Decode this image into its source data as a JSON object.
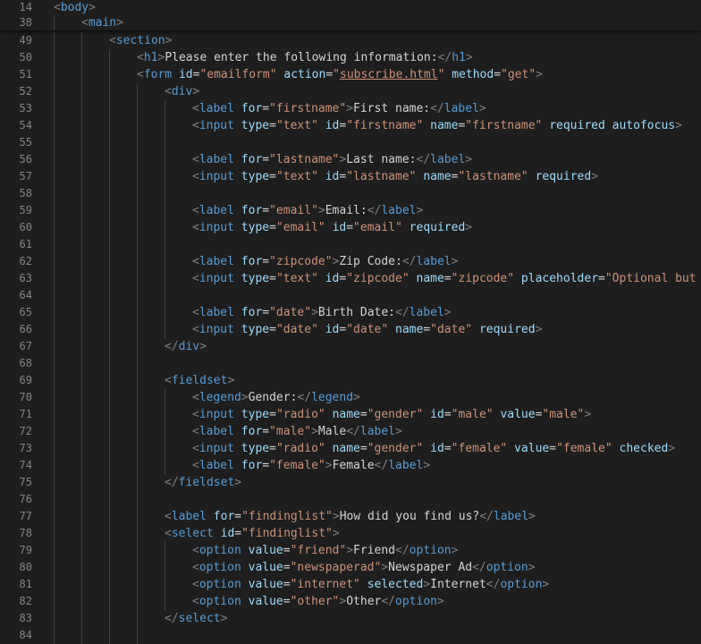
{
  "sticky": [
    {
      "n": "14",
      "indent": 0,
      "segs": [
        [
          "p",
          "<"
        ],
        [
          "t",
          "body"
        ],
        [
          "p",
          ">"
        ]
      ]
    },
    {
      "n": "38",
      "indent": 1,
      "segs": [
        [
          "p",
          "<"
        ],
        [
          "t",
          "main"
        ],
        [
          "p",
          ">"
        ]
      ]
    }
  ],
  "lines": [
    {
      "n": "49",
      "indent": 2,
      "segs": [
        [
          "p",
          "<"
        ],
        [
          "t",
          "section"
        ],
        [
          "p",
          ">"
        ]
      ]
    },
    {
      "n": "50",
      "indent": 3,
      "segs": [
        [
          "p",
          "<"
        ],
        [
          "t",
          "h1"
        ],
        [
          "p",
          ">"
        ],
        [
          "tx",
          "Please enter the following information:"
        ],
        [
          "p",
          "</"
        ],
        [
          "t",
          "h1"
        ],
        [
          "p",
          ">"
        ]
      ]
    },
    {
      "n": "51",
      "indent": 3,
      "segs": [
        [
          "p",
          "<"
        ],
        [
          "t",
          "form"
        ],
        [
          "tx",
          " "
        ],
        [
          "a",
          "id"
        ],
        [
          "tx",
          "="
        ],
        [
          "v",
          "\"emailform\""
        ],
        [
          "tx",
          " "
        ],
        [
          "a",
          "action"
        ],
        [
          "tx",
          "="
        ],
        [
          "v",
          "\""
        ],
        [
          "vu",
          "subscribe.html"
        ],
        [
          "v",
          "\""
        ],
        [
          "tx",
          " "
        ],
        [
          "a",
          "method"
        ],
        [
          "tx",
          "="
        ],
        [
          "v",
          "\"get\""
        ],
        [
          "p",
          ">"
        ]
      ]
    },
    {
      "n": "52",
      "indent": 4,
      "segs": [
        [
          "p",
          "<"
        ],
        [
          "t",
          "div"
        ],
        [
          "p",
          ">"
        ]
      ]
    },
    {
      "n": "53",
      "indent": 5,
      "segs": [
        [
          "p",
          "<"
        ],
        [
          "t",
          "label"
        ],
        [
          "tx",
          " "
        ],
        [
          "a",
          "for"
        ],
        [
          "tx",
          "="
        ],
        [
          "v",
          "\"firstname\""
        ],
        [
          "p",
          ">"
        ],
        [
          "tx",
          "First name:"
        ],
        [
          "p",
          "</"
        ],
        [
          "t",
          "label"
        ],
        [
          "p",
          ">"
        ]
      ]
    },
    {
      "n": "54",
      "indent": 5,
      "segs": [
        [
          "p",
          "<"
        ],
        [
          "t",
          "input"
        ],
        [
          "tx",
          " "
        ],
        [
          "a",
          "type"
        ],
        [
          "tx",
          "="
        ],
        [
          "v",
          "\"text\""
        ],
        [
          "tx",
          " "
        ],
        [
          "a",
          "id"
        ],
        [
          "tx",
          "="
        ],
        [
          "v",
          "\"firstname\""
        ],
        [
          "tx",
          " "
        ],
        [
          "a",
          "name"
        ],
        [
          "tx",
          "="
        ],
        [
          "v",
          "\"firstname\""
        ],
        [
          "tx",
          " "
        ],
        [
          "a",
          "required"
        ],
        [
          "tx",
          " "
        ],
        [
          "a",
          "autofocus"
        ],
        [
          "p",
          ">"
        ]
      ]
    },
    {
      "n": "55",
      "indent": 5,
      "segs": []
    },
    {
      "n": "56",
      "indent": 5,
      "segs": [
        [
          "p",
          "<"
        ],
        [
          "t",
          "label"
        ],
        [
          "tx",
          " "
        ],
        [
          "a",
          "for"
        ],
        [
          "tx",
          "="
        ],
        [
          "v",
          "\"lastname\""
        ],
        [
          "p",
          ">"
        ],
        [
          "tx",
          "Last name:"
        ],
        [
          "p",
          "</"
        ],
        [
          "t",
          "label"
        ],
        [
          "p",
          ">"
        ]
      ]
    },
    {
      "n": "57",
      "indent": 5,
      "segs": [
        [
          "p",
          "<"
        ],
        [
          "t",
          "input"
        ],
        [
          "tx",
          " "
        ],
        [
          "a",
          "type"
        ],
        [
          "tx",
          "="
        ],
        [
          "v",
          "\"text\""
        ],
        [
          "tx",
          " "
        ],
        [
          "a",
          "id"
        ],
        [
          "tx",
          "="
        ],
        [
          "v",
          "\"lastname\""
        ],
        [
          "tx",
          " "
        ],
        [
          "a",
          "name"
        ],
        [
          "tx",
          "="
        ],
        [
          "v",
          "\"lastname\""
        ],
        [
          "tx",
          " "
        ],
        [
          "a",
          "required"
        ],
        [
          "p",
          ">"
        ]
      ]
    },
    {
      "n": "58",
      "indent": 5,
      "segs": []
    },
    {
      "n": "59",
      "indent": 5,
      "segs": [
        [
          "p",
          "<"
        ],
        [
          "t",
          "label"
        ],
        [
          "tx",
          " "
        ],
        [
          "a",
          "for"
        ],
        [
          "tx",
          "="
        ],
        [
          "v",
          "\"email\""
        ],
        [
          "p",
          ">"
        ],
        [
          "tx",
          "Email:"
        ],
        [
          "p",
          "</"
        ],
        [
          "t",
          "label"
        ],
        [
          "p",
          ">"
        ]
      ]
    },
    {
      "n": "60",
      "indent": 5,
      "segs": [
        [
          "p",
          "<"
        ],
        [
          "t",
          "input"
        ],
        [
          "tx",
          " "
        ],
        [
          "a",
          "type"
        ],
        [
          "tx",
          "="
        ],
        [
          "v",
          "\"email\""
        ],
        [
          "tx",
          " "
        ],
        [
          "a",
          "id"
        ],
        [
          "tx",
          "="
        ],
        [
          "v",
          "\"email\""
        ],
        [
          "tx",
          " "
        ],
        [
          "a",
          "required"
        ],
        [
          "p",
          ">"
        ]
      ]
    },
    {
      "n": "61",
      "indent": 5,
      "segs": []
    },
    {
      "n": "62",
      "indent": 5,
      "segs": [
        [
          "p",
          "<"
        ],
        [
          "t",
          "label"
        ],
        [
          "tx",
          " "
        ],
        [
          "a",
          "for"
        ],
        [
          "tx",
          "="
        ],
        [
          "v",
          "\"zipcode\""
        ],
        [
          "p",
          ">"
        ],
        [
          "tx",
          "Zip Code:"
        ],
        [
          "p",
          "</"
        ],
        [
          "t",
          "label"
        ],
        [
          "p",
          ">"
        ]
      ]
    },
    {
      "n": "63",
      "indent": 5,
      "segs": [
        [
          "p",
          "<"
        ],
        [
          "t",
          "input"
        ],
        [
          "tx",
          " "
        ],
        [
          "a",
          "type"
        ],
        [
          "tx",
          "="
        ],
        [
          "v",
          "\"text\""
        ],
        [
          "tx",
          " "
        ],
        [
          "a",
          "id"
        ],
        [
          "tx",
          "="
        ],
        [
          "v",
          "\"zipcode\""
        ],
        [
          "tx",
          " "
        ],
        [
          "a",
          "name"
        ],
        [
          "tx",
          "="
        ],
        [
          "v",
          "\"zipcode\""
        ],
        [
          "tx",
          " "
        ],
        [
          "a",
          "placeholder"
        ],
        [
          "tx",
          "="
        ],
        [
          "v",
          "\"Optional but a"
        ]
      ]
    },
    {
      "n": "64",
      "indent": 5,
      "segs": []
    },
    {
      "n": "65",
      "indent": 5,
      "segs": [
        [
          "p",
          "<"
        ],
        [
          "t",
          "label"
        ],
        [
          "tx",
          " "
        ],
        [
          "a",
          "for"
        ],
        [
          "tx",
          "="
        ],
        [
          "v",
          "\"date\""
        ],
        [
          "p",
          ">"
        ],
        [
          "tx",
          "Birth Date:"
        ],
        [
          "p",
          "</"
        ],
        [
          "t",
          "label"
        ],
        [
          "p",
          ">"
        ]
      ]
    },
    {
      "n": "66",
      "indent": 5,
      "segs": [
        [
          "p",
          "<"
        ],
        [
          "t",
          "input"
        ],
        [
          "tx",
          " "
        ],
        [
          "a",
          "type"
        ],
        [
          "tx",
          "="
        ],
        [
          "v",
          "\"date\""
        ],
        [
          "tx",
          " "
        ],
        [
          "a",
          "id"
        ],
        [
          "tx",
          "="
        ],
        [
          "v",
          "\"date\""
        ],
        [
          "tx",
          " "
        ],
        [
          "a",
          "name"
        ],
        [
          "tx",
          "="
        ],
        [
          "v",
          "\"date\""
        ],
        [
          "tx",
          " "
        ],
        [
          "a",
          "required"
        ],
        [
          "p",
          ">"
        ]
      ]
    },
    {
      "n": "67",
      "indent": 4,
      "segs": [
        [
          "p",
          "</"
        ],
        [
          "t",
          "div"
        ],
        [
          "p",
          ">"
        ]
      ]
    },
    {
      "n": "68",
      "indent": 4,
      "segs": []
    },
    {
      "n": "69",
      "indent": 4,
      "segs": [
        [
          "p",
          "<"
        ],
        [
          "t",
          "fieldset"
        ],
        [
          "p",
          ">"
        ]
      ]
    },
    {
      "n": "70",
      "indent": 5,
      "segs": [
        [
          "p",
          "<"
        ],
        [
          "t",
          "legend"
        ],
        [
          "p",
          ">"
        ],
        [
          "tx",
          "Gender:"
        ],
        [
          "p",
          "</"
        ],
        [
          "t",
          "legend"
        ],
        [
          "p",
          ">"
        ]
      ]
    },
    {
      "n": "71",
      "indent": 5,
      "segs": [
        [
          "p",
          "<"
        ],
        [
          "t",
          "input"
        ],
        [
          "tx",
          " "
        ],
        [
          "a",
          "type"
        ],
        [
          "tx",
          "="
        ],
        [
          "v",
          "\"radio\""
        ],
        [
          "tx",
          " "
        ],
        [
          "a",
          "name"
        ],
        [
          "tx",
          "="
        ],
        [
          "v",
          "\"gender\""
        ],
        [
          "tx",
          " "
        ],
        [
          "a",
          "id"
        ],
        [
          "tx",
          "="
        ],
        [
          "v",
          "\"male\""
        ],
        [
          "tx",
          " "
        ],
        [
          "a",
          "value"
        ],
        [
          "tx",
          "="
        ],
        [
          "v",
          "\"male\""
        ],
        [
          "p",
          ">"
        ]
      ]
    },
    {
      "n": "72",
      "indent": 5,
      "segs": [
        [
          "p",
          "<"
        ],
        [
          "t",
          "label"
        ],
        [
          "tx",
          " "
        ],
        [
          "a",
          "for"
        ],
        [
          "tx",
          "="
        ],
        [
          "v",
          "\"male\""
        ],
        [
          "p",
          ">"
        ],
        [
          "tx",
          "Male"
        ],
        [
          "p",
          "</"
        ],
        [
          "t",
          "label"
        ],
        [
          "p",
          ">"
        ]
      ]
    },
    {
      "n": "73",
      "indent": 5,
      "segs": [
        [
          "p",
          "<"
        ],
        [
          "t",
          "input"
        ],
        [
          "tx",
          " "
        ],
        [
          "a",
          "type"
        ],
        [
          "tx",
          "="
        ],
        [
          "v",
          "\"radio\""
        ],
        [
          "tx",
          " "
        ],
        [
          "a",
          "name"
        ],
        [
          "tx",
          "="
        ],
        [
          "v",
          "\"gender\""
        ],
        [
          "tx",
          " "
        ],
        [
          "a",
          "id"
        ],
        [
          "tx",
          "="
        ],
        [
          "v",
          "\"female\""
        ],
        [
          "tx",
          " "
        ],
        [
          "a",
          "value"
        ],
        [
          "tx",
          "="
        ],
        [
          "v",
          "\"female\""
        ],
        [
          "tx",
          " "
        ],
        [
          "a",
          "checked"
        ],
        [
          "p",
          ">"
        ]
      ]
    },
    {
      "n": "74",
      "indent": 5,
      "segs": [
        [
          "p",
          "<"
        ],
        [
          "t",
          "label"
        ],
        [
          "tx",
          " "
        ],
        [
          "a",
          "for"
        ],
        [
          "tx",
          "="
        ],
        [
          "v",
          "\"female\""
        ],
        [
          "p",
          ">"
        ],
        [
          "tx",
          "Female"
        ],
        [
          "p",
          "</"
        ],
        [
          "t",
          "label"
        ],
        [
          "p",
          ">"
        ]
      ]
    },
    {
      "n": "75",
      "indent": 4,
      "segs": [
        [
          "p",
          "</"
        ],
        [
          "t",
          "fieldset"
        ],
        [
          "p",
          ">"
        ]
      ]
    },
    {
      "n": "76",
      "indent": 4,
      "segs": []
    },
    {
      "n": "77",
      "indent": 4,
      "segs": [
        [
          "p",
          "<"
        ],
        [
          "t",
          "label"
        ],
        [
          "tx",
          " "
        ],
        [
          "a",
          "for"
        ],
        [
          "tx",
          "="
        ],
        [
          "v",
          "\"findinglist\""
        ],
        [
          "p",
          ">"
        ],
        [
          "tx",
          "How did you find us?"
        ],
        [
          "p",
          "</"
        ],
        [
          "t",
          "label"
        ],
        [
          "p",
          ">"
        ]
      ]
    },
    {
      "n": "78",
      "indent": 4,
      "segs": [
        [
          "p",
          "<"
        ],
        [
          "t",
          "select"
        ],
        [
          "tx",
          " "
        ],
        [
          "a",
          "id"
        ],
        [
          "tx",
          "="
        ],
        [
          "v",
          "\"findinglist\""
        ],
        [
          "p",
          ">"
        ]
      ]
    },
    {
      "n": "79",
      "indent": 5,
      "segs": [
        [
          "p",
          "<"
        ],
        [
          "t",
          "option"
        ],
        [
          "tx",
          " "
        ],
        [
          "a",
          "value"
        ],
        [
          "tx",
          "="
        ],
        [
          "v",
          "\"friend\""
        ],
        [
          "p",
          ">"
        ],
        [
          "tx",
          "Friend"
        ],
        [
          "p",
          "</"
        ],
        [
          "t",
          "option"
        ],
        [
          "p",
          ">"
        ]
      ]
    },
    {
      "n": "80",
      "indent": 5,
      "segs": [
        [
          "p",
          "<"
        ],
        [
          "t",
          "option"
        ],
        [
          "tx",
          " "
        ],
        [
          "a",
          "value"
        ],
        [
          "tx",
          "="
        ],
        [
          "v",
          "\"newspaperad\""
        ],
        [
          "p",
          ">"
        ],
        [
          "tx",
          "Newspaper Ad"
        ],
        [
          "p",
          "</"
        ],
        [
          "t",
          "option"
        ],
        [
          "p",
          ">"
        ]
      ]
    },
    {
      "n": "81",
      "indent": 5,
      "segs": [
        [
          "p",
          "<"
        ],
        [
          "t",
          "option"
        ],
        [
          "tx",
          " "
        ],
        [
          "a",
          "value"
        ],
        [
          "tx",
          "="
        ],
        [
          "v",
          "\"internet\""
        ],
        [
          "tx",
          " "
        ],
        [
          "a",
          "selected"
        ],
        [
          "p",
          ">"
        ],
        [
          "tx",
          "Internet"
        ],
        [
          "p",
          "</"
        ],
        [
          "t",
          "option"
        ],
        [
          "p",
          ">"
        ]
      ]
    },
    {
      "n": "82",
      "indent": 5,
      "segs": [
        [
          "p",
          "<"
        ],
        [
          "t",
          "option"
        ],
        [
          "tx",
          " "
        ],
        [
          "a",
          "value"
        ],
        [
          "tx",
          "="
        ],
        [
          "v",
          "\"other\""
        ],
        [
          "p",
          ">"
        ],
        [
          "tx",
          "Other"
        ],
        [
          "p",
          "</"
        ],
        [
          "t",
          "option"
        ],
        [
          "p",
          ">"
        ]
      ]
    },
    {
      "n": "83",
      "indent": 4,
      "segs": [
        [
          "p",
          "</"
        ],
        [
          "t",
          "select"
        ],
        [
          "p",
          ">"
        ]
      ]
    },
    {
      "n": "84",
      "indent": 4,
      "segs": []
    }
  ]
}
